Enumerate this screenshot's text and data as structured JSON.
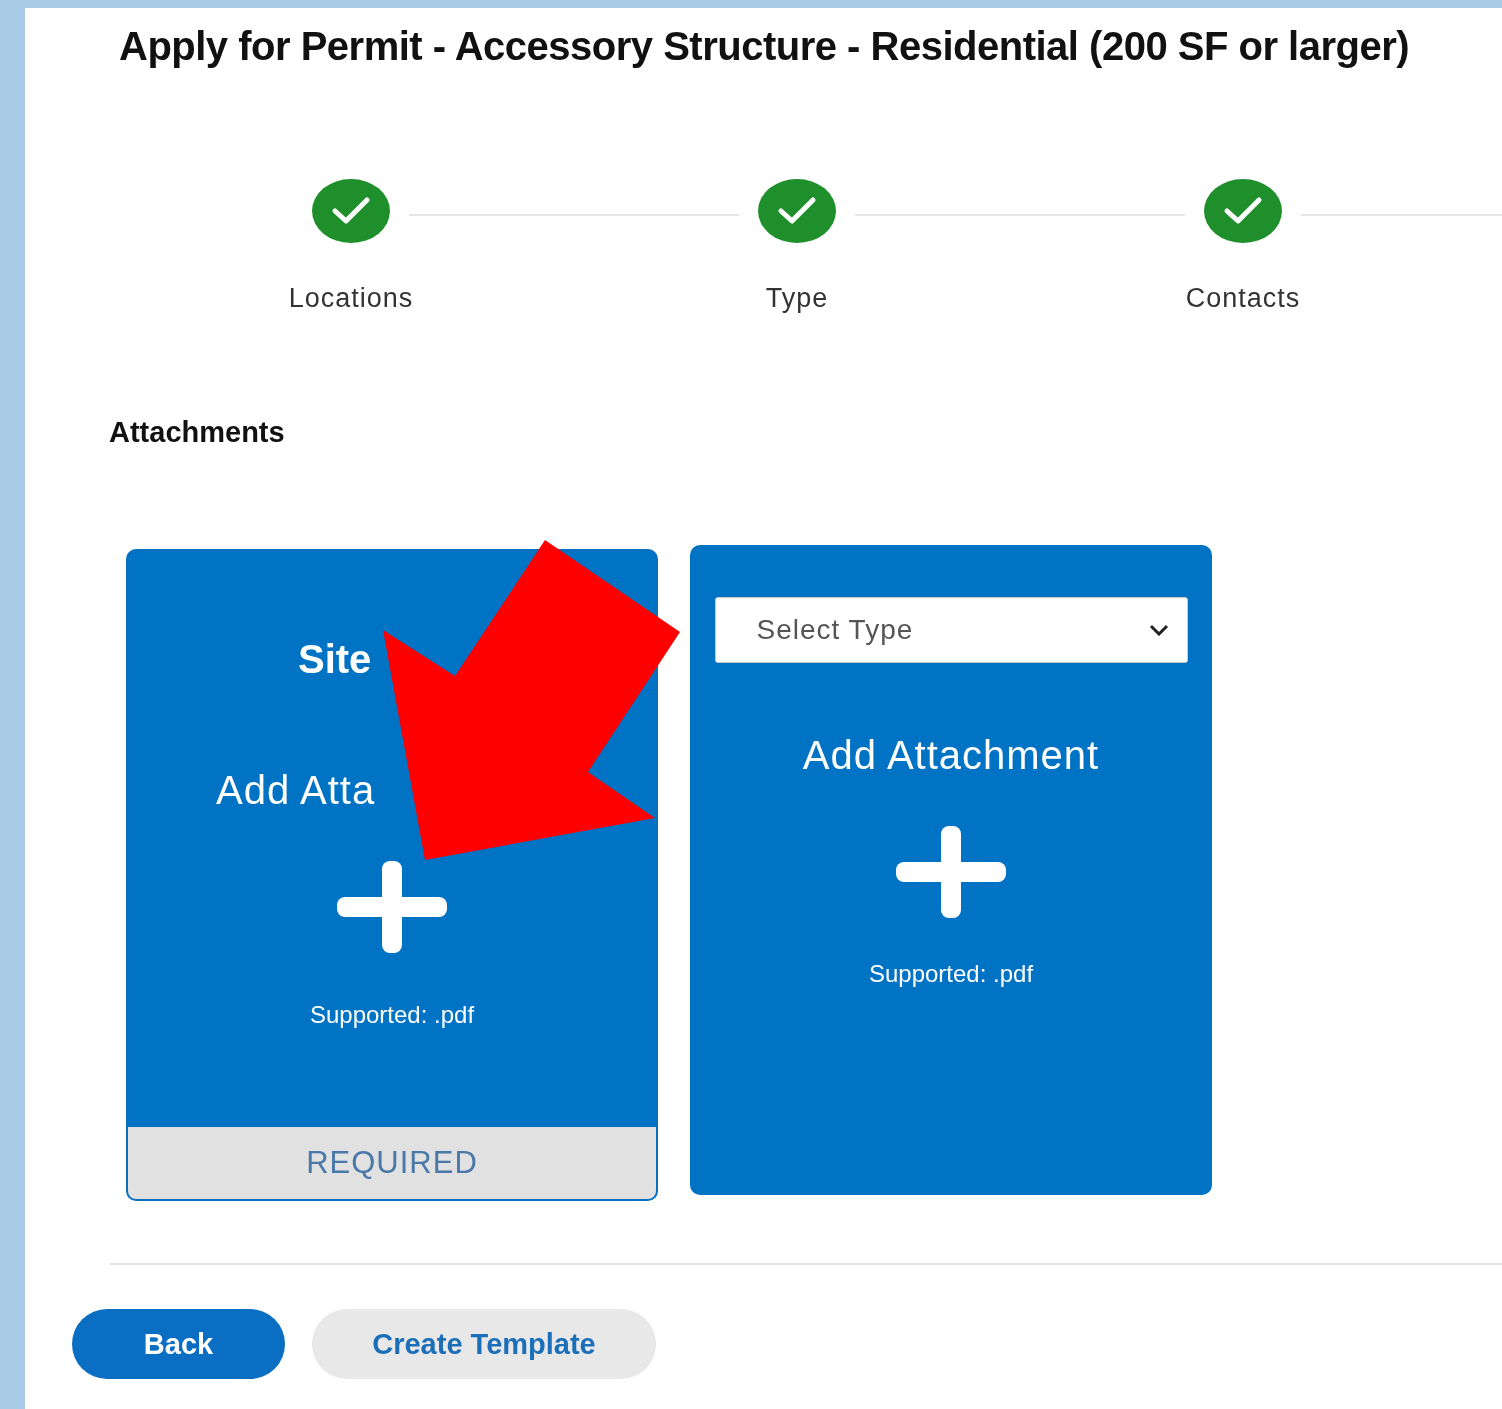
{
  "title": "Apply for Permit - Accessory Structure - Residential (200 SF or larger)",
  "steps": [
    {
      "label": "Locations",
      "done": true
    },
    {
      "label": "Type",
      "done": true
    },
    {
      "label": "Contacts",
      "done": true
    }
  ],
  "section_title": "Attachments",
  "cards": [
    {
      "kind": "required",
      "name": "Site",
      "action": "Add Atta",
      "supported": "Supported: .pdf",
      "footer": "REQUIRED"
    },
    {
      "kind": "select",
      "placeholder": "Select Type",
      "action": "Add Attachment",
      "supported": "Supported: .pdf"
    }
  ],
  "buttons": [
    {
      "label": "Back",
      "primary": true
    },
    {
      "label": "Create Template",
      "primary": false
    }
  ]
}
